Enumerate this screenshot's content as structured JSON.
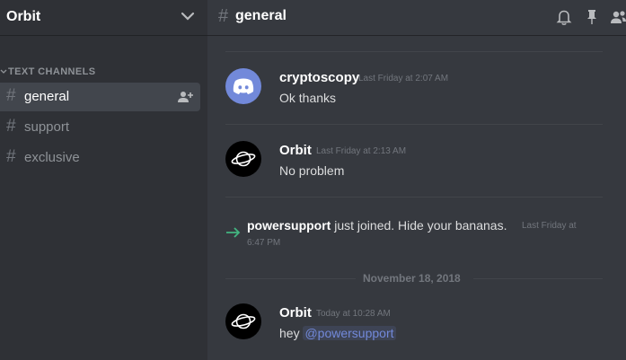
{
  "server": {
    "name": "Orbit"
  },
  "sidebar": {
    "category": "TEXT CHANNELS",
    "channels": [
      {
        "hash": "#",
        "label": "general"
      },
      {
        "hash": "#",
        "label": "support"
      },
      {
        "hash": "#",
        "label": "exclusive"
      }
    ]
  },
  "header": {
    "hash": "#",
    "channel": "general"
  },
  "messages": [
    {
      "author": "cryptoscopy",
      "timestamp": "Last Friday at 2:07 AM",
      "text": "Ok thanks",
      "avatar_icon": "discord-logo-icon"
    },
    {
      "author": "Orbit",
      "timestamp": "Last Friday at 2:13 AM",
      "text": "No problem",
      "avatar_icon": "planet-icon"
    }
  ],
  "join": {
    "user": "powersupport",
    "text": " just joined. Hide your bananas.",
    "timestamp_line1": "Last Friday at",
    "timestamp_line2": "6:47 PM"
  },
  "date_separator": "November 18, 2018",
  "last_message": {
    "author": "Orbit",
    "timestamp": "Today at 10:28 AM",
    "text_prefix": "hey ",
    "mention": "@powersupport",
    "avatar_icon": "planet-icon"
  },
  "colors": {
    "sidebar_bg": "#2f3136",
    "chat_bg": "#36393f",
    "active_channel_bg": "#42464d",
    "blurple": "#7289da",
    "join_arrow": "#43b581"
  }
}
